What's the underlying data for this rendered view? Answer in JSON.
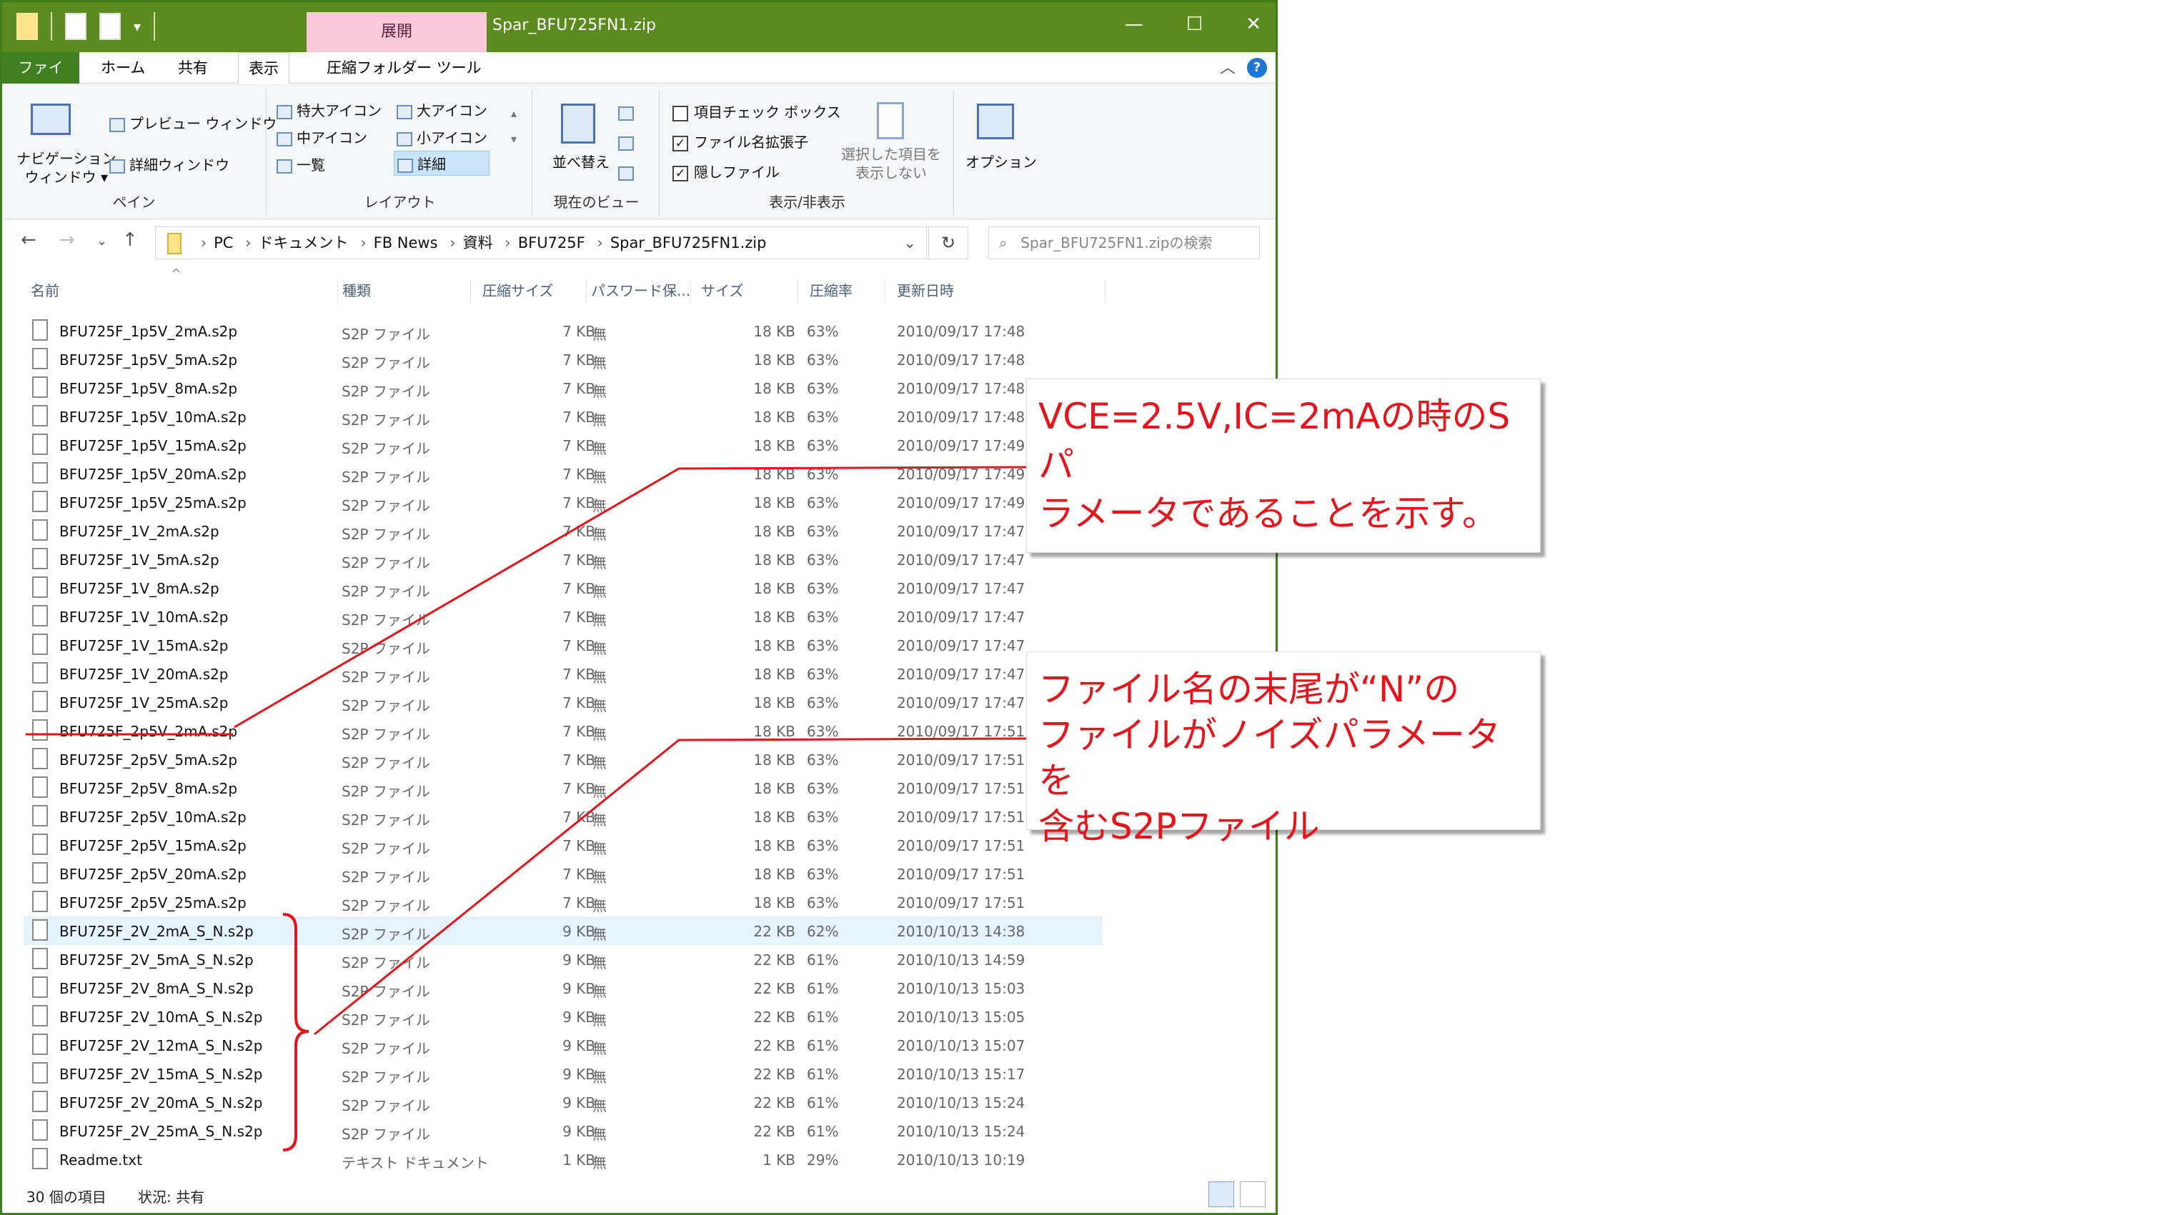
{
  "window": {
    "title": "Spar_BFU725FN1.zip",
    "context_tab": "展開",
    "minimize": "—",
    "maximize": "☐",
    "close": "✕"
  },
  "menu": {
    "file": "ファイル",
    "home": "ホーム",
    "share": "共有",
    "view": "表示",
    "tools": "圧縮フォルダー ツール",
    "help": "?"
  },
  "ribbon": {
    "nav_pane": "ナビゲーション\nウィンドウ ▾",
    "preview_pane": "プレビュー ウィンドウ",
    "details_pane": "詳細ウィンドウ",
    "pane_label": "ペイン",
    "layout": {
      "xl_icons": "特大アイコン",
      "l_icons": "大アイコン",
      "m_icons": "中アイコン",
      "s_icons": "小アイコン",
      "list": "一覧",
      "details": "詳細",
      "label": "レイアウト"
    },
    "sort": "並べ替え",
    "current_view_label": "現在のビュー",
    "checkbox_items": "項目チェック ボックス",
    "ext": "ファイル名拡張子",
    "hidden": "隠しファイル",
    "hide_selected": "選択した項目を\n表示しない",
    "show_hide_label": "表示/非表示",
    "options": "オプション"
  },
  "address": {
    "crumbs": [
      "PC",
      "ドキュメント",
      "FB News",
      "資料",
      "BFU725F",
      "Spar_BFU725FN1.zip"
    ],
    "search_placeholder": "Spar_BFU725FN1.zipの検索"
  },
  "columns": {
    "name": "名前",
    "type": "種類",
    "csize": "圧縮サイズ",
    "pw": "パスワード保...",
    "size": "サイズ",
    "ratio": "圧縮率",
    "date": "更新日時"
  },
  "files": [
    {
      "name": "BFU725F_1p5V_2mA.s2p",
      "type": "S2P ファイル",
      "csize": "7 KB",
      "pw": "無",
      "size": "18 KB",
      "ratio": "63%",
      "date": "2010/09/17 17:48"
    },
    {
      "name": "BFU725F_1p5V_5mA.s2p",
      "type": "S2P ファイル",
      "csize": "7 KB",
      "pw": "無",
      "size": "18 KB",
      "ratio": "63%",
      "date": "2010/09/17 17:48"
    },
    {
      "name": "BFU725F_1p5V_8mA.s2p",
      "type": "S2P ファイル",
      "csize": "7 KB",
      "pw": "無",
      "size": "18 KB",
      "ratio": "63%",
      "date": "2010/09/17 17:48"
    },
    {
      "name": "BFU725F_1p5V_10mA.s2p",
      "type": "S2P ファイル",
      "csize": "7 KB",
      "pw": "無",
      "size": "18 KB",
      "ratio": "63%",
      "date": "2010/09/17 17:48"
    },
    {
      "name": "BFU725F_1p5V_15mA.s2p",
      "type": "S2P ファイル",
      "csize": "7 KB",
      "pw": "無",
      "size": "18 KB",
      "ratio": "63%",
      "date": "2010/09/17 17:49"
    },
    {
      "name": "BFU725F_1p5V_20mA.s2p",
      "type": "S2P ファイル",
      "csize": "7 KB",
      "pw": "無",
      "size": "18 KB",
      "ratio": "63%",
      "date": "2010/09/17 17:49"
    },
    {
      "name": "BFU725F_1p5V_25mA.s2p",
      "type": "S2P ファイル",
      "csize": "7 KB",
      "pw": "無",
      "size": "18 KB",
      "ratio": "63%",
      "date": "2010/09/17 17:49"
    },
    {
      "name": "BFU725F_1V_2mA.s2p",
      "type": "S2P ファイル",
      "csize": "7 KB",
      "pw": "無",
      "size": "18 KB",
      "ratio": "63%",
      "date": "2010/09/17 17:47"
    },
    {
      "name": "BFU725F_1V_5mA.s2p",
      "type": "S2P ファイル",
      "csize": "7 KB",
      "pw": "無",
      "size": "18 KB",
      "ratio": "63%",
      "date": "2010/09/17 17:47"
    },
    {
      "name": "BFU725F_1V_8mA.s2p",
      "type": "S2P ファイル",
      "csize": "7 KB",
      "pw": "無",
      "size": "18 KB",
      "ratio": "63%",
      "date": "2010/09/17 17:47"
    },
    {
      "name": "BFU725F_1V_10mA.s2p",
      "type": "S2P ファイル",
      "csize": "7 KB",
      "pw": "無",
      "size": "18 KB",
      "ratio": "63%",
      "date": "2010/09/17 17:47"
    },
    {
      "name": "BFU725F_1V_15mA.s2p",
      "type": "S2P ファイル",
      "csize": "7 KB",
      "pw": "無",
      "size": "18 KB",
      "ratio": "63%",
      "date": "2010/09/17 17:47"
    },
    {
      "name": "BFU725F_1V_20mA.s2p",
      "type": "S2P ファイル",
      "csize": "7 KB",
      "pw": "無",
      "size": "18 KB",
      "ratio": "63%",
      "date": "2010/09/17 17:47"
    },
    {
      "name": "BFU725F_1V_25mA.s2p",
      "type": "S2P ファイル",
      "csize": "7 KB",
      "pw": "無",
      "size": "18 KB",
      "ratio": "63%",
      "date": "2010/09/17 17:47"
    },
    {
      "name": "BFU725F_2p5V_2mA.s2p",
      "type": "S2P ファイル",
      "csize": "7 KB",
      "pw": "無",
      "size": "18 KB",
      "ratio": "63%",
      "date": "2010/09/17 17:51"
    },
    {
      "name": "BFU725F_2p5V_5mA.s2p",
      "type": "S2P ファイル",
      "csize": "7 KB",
      "pw": "無",
      "size": "18 KB",
      "ratio": "63%",
      "date": "2010/09/17 17:51"
    },
    {
      "name": "BFU725F_2p5V_8mA.s2p",
      "type": "S2P ファイル",
      "csize": "7 KB",
      "pw": "無",
      "size": "18 KB",
      "ratio": "63%",
      "date": "2010/09/17 17:51"
    },
    {
      "name": "BFU725F_2p5V_10mA.s2p",
      "type": "S2P ファイル",
      "csize": "7 KB",
      "pw": "無",
      "size": "18 KB",
      "ratio": "63%",
      "date": "2010/09/17 17:51"
    },
    {
      "name": "BFU725F_2p5V_15mA.s2p",
      "type": "S2P ファイル",
      "csize": "7 KB",
      "pw": "無",
      "size": "18 KB",
      "ratio": "63%",
      "date": "2010/09/17 17:51"
    },
    {
      "name": "BFU725F_2p5V_20mA.s2p",
      "type": "S2P ファイル",
      "csize": "7 KB",
      "pw": "無",
      "size": "18 KB",
      "ratio": "63%",
      "date": "2010/09/17 17:51"
    },
    {
      "name": "BFU725F_2p5V_25mA.s2p",
      "type": "S2P ファイル",
      "csize": "7 KB",
      "pw": "無",
      "size": "18 KB",
      "ratio": "63%",
      "date": "2010/09/17 17:51"
    },
    {
      "name": "BFU725F_2V_2mA_S_N.s2p",
      "type": "S2P ファイル",
      "csize": "9 KB",
      "pw": "無",
      "size": "22 KB",
      "ratio": "62%",
      "date": "2010/10/13 14:38"
    },
    {
      "name": "BFU725F_2V_5mA_S_N.s2p",
      "type": "S2P ファイル",
      "csize": "9 KB",
      "pw": "無",
      "size": "22 KB",
      "ratio": "61%",
      "date": "2010/10/13 14:59"
    },
    {
      "name": "BFU725F_2V_8mA_S_N.s2p",
      "type": "S2P ファイル",
      "csize": "9 KB",
      "pw": "無",
      "size": "22 KB",
      "ratio": "61%",
      "date": "2010/10/13 15:03"
    },
    {
      "name": "BFU725F_2V_10mA_S_N.s2p",
      "type": "S2P ファイル",
      "csize": "9 KB",
      "pw": "無",
      "size": "22 KB",
      "ratio": "61%",
      "date": "2010/10/13 15:05"
    },
    {
      "name": "BFU725F_2V_12mA_S_N.s2p",
      "type": "S2P ファイル",
      "csize": "9 KB",
      "pw": "無",
      "size": "22 KB",
      "ratio": "61%",
      "date": "2010/10/13 15:07"
    },
    {
      "name": "BFU725F_2V_15mA_S_N.s2p",
      "type": "S2P ファイル",
      "csize": "9 KB",
      "pw": "無",
      "size": "22 KB",
      "ratio": "61%",
      "date": "2010/10/13 15:17"
    },
    {
      "name": "BFU725F_2V_20mA_S_N.s2p",
      "type": "S2P ファイル",
      "csize": "9 KB",
      "pw": "無",
      "size": "22 KB",
      "ratio": "61%",
      "date": "2010/10/13 15:24"
    },
    {
      "name": "BFU725F_2V_25mA_S_N.s2p",
      "type": "S2P ファイル",
      "csize": "9 KB",
      "pw": "無",
      "size": "22 KB",
      "ratio": "61%",
      "date": "2010/10/13 15:24"
    },
    {
      "name": "Readme.txt",
      "type": "テキスト ドキュメント",
      "csize": "1 KB",
      "pw": "無",
      "size": "1 KB",
      "ratio": "29%",
      "date": "2010/10/13 10:19"
    }
  ],
  "status": {
    "count": "30 個の項目",
    "state": "状況: 共有"
  },
  "callouts": {
    "first": [
      "VCE=2.5V,IC=2mAの時のSパ",
      "ラメータであることを示す。"
    ],
    "second": [
      "ファイル名の末尾が“N”の",
      "ファイルがノイズパラメータを",
      "含むS2Pファイル"
    ]
  },
  "colors": {
    "title_green": "#5b8a1f",
    "file_tab": "#3f8020",
    "context_pink": "#f7c8d8",
    "callout_red": "#e8141b"
  }
}
